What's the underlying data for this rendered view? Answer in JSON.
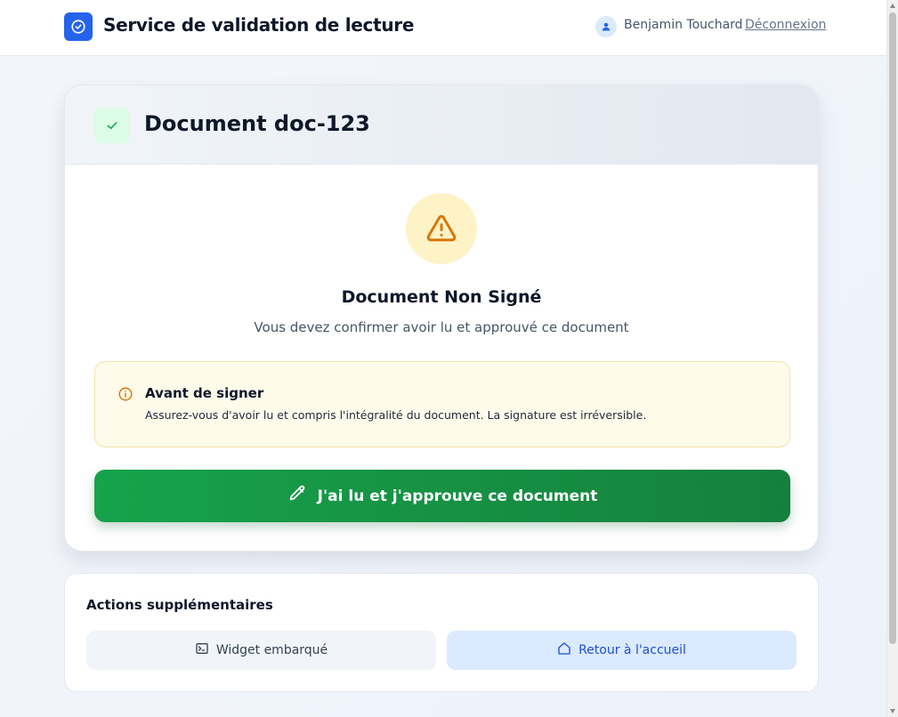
{
  "header": {
    "app_title": "Service de validation de lecture",
    "user_name": "Benjamin Touchard",
    "logout_label": "Déconnexion"
  },
  "document": {
    "title": "Document doc-123",
    "status_title": "Document Non Signé",
    "status_subtitle": "Vous devez confirmer avoir lu et approuvé ce document",
    "notice_title": "Avant de signer",
    "notice_text": "Assurez-vous d'avoir lu et compris l'intégralité du document. La signature est irréversible.",
    "sign_button_label": "J'ai lu et j'approuve ce document"
  },
  "actions": {
    "title": "Actions supplémentaires",
    "widget_label": "Widget embarqué",
    "home_label": "Retour à l'accueil"
  },
  "icons": {
    "brand": "check-circle-icon",
    "user": "user-icon",
    "document_status": "check-icon",
    "warning": "warning-triangle-icon",
    "notice": "info-circle-icon",
    "sign": "pencil-icon",
    "widget": "terminal-icon",
    "home": "home-icon"
  },
  "colors": {
    "primary": "#2563eb",
    "success": "#16a34a",
    "warning": "#d97706",
    "warning_bg": "#fef3c7",
    "notice_bg": "#fefbea"
  }
}
